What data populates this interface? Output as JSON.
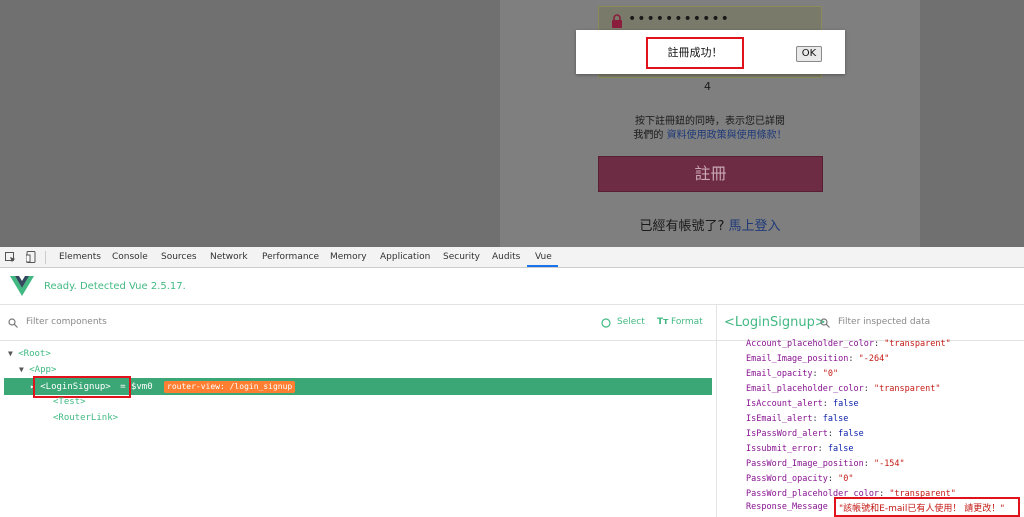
{
  "page": {
    "password_dots": "•••••••••••",
    "digit": "4",
    "terms_line1": "按下註冊鈕的同時，表示您已詳閱",
    "terms_line2_prefix": "我們的",
    "terms_link": "資料使用政策與使用條款！",
    "signup_button": "註冊",
    "login_prompt": "已經有帳號了?",
    "login_link": "馬上登入"
  },
  "alert": {
    "message": "註冊成功！",
    "ok_label": "OK"
  },
  "devtools": {
    "tabs": [
      "Elements",
      "Console",
      "Sources",
      "Network",
      "Performance",
      "Memory",
      "Application",
      "Security",
      "Audits",
      "Vue"
    ],
    "active_tab": "Vue",
    "vue_ready": "Ready. Detected Vue 2.5.17.",
    "filter_components_placeholder": "Filter components",
    "select_label": "Select",
    "format_label": "Format",
    "tree": {
      "root": "Root",
      "app": "App",
      "login_signup": "LoginSignup",
      "vm_ref": "= $vm0",
      "router_badge": "router-view: /login_signup",
      "test": "Test",
      "router_link": "RouterLink"
    },
    "inspected_component": "LoginSignup",
    "filter_inspected_placeholder": "Filter inspected data",
    "props": [
      {
        "key": "Account_placeholder_color",
        "value": "\"transparent\"",
        "kind": "str"
      },
      {
        "key": "Email_Image_position",
        "value": "\"-264\"",
        "kind": "str"
      },
      {
        "key": "Email_opacity",
        "value": "\"0\"",
        "kind": "str"
      },
      {
        "key": "Email_placeholder_color",
        "value": "\"transparent\"",
        "kind": "str"
      },
      {
        "key": "IsAccount_alert",
        "value": "false",
        "kind": "bool"
      },
      {
        "key": "IsEmail_alert",
        "value": "false",
        "kind": "bool"
      },
      {
        "key": "IsPassWord_alert",
        "value": "false",
        "kind": "bool"
      },
      {
        "key": "Issubmit_error",
        "value": "false",
        "kind": "bool"
      },
      {
        "key": "PassWord_Image_position",
        "value": "\"-154\"",
        "kind": "str"
      },
      {
        "key": "PassWord_opacity",
        "value": "\"0\"",
        "kind": "str"
      },
      {
        "key": "PassWord_placeholder_color",
        "value": "\"transparent\"",
        "kind": "str"
      }
    ],
    "response_message_key": "Response_Message",
    "response_message_value": "\"該帳號和E-mail已有人使用！  請更改！\""
  },
  "colors": {
    "vue_green": "#42b983",
    "highlight_red": "#e0121b",
    "badge_orange": "#ff7f32"
  }
}
